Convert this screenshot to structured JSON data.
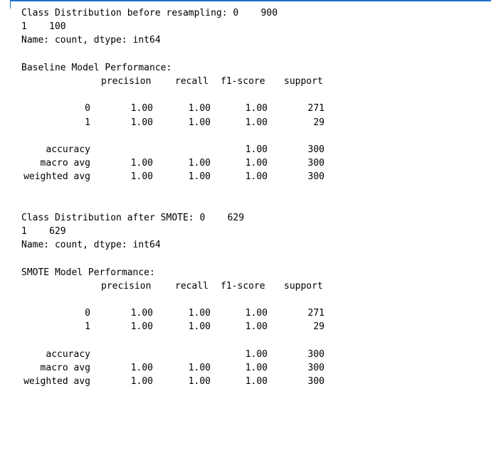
{
  "output": {
    "baseline": {
      "dist_line1": "Class Distribution before resampling: 0    900",
      "dist_line2": "1    100",
      "name_line": "Name: count, dtype: int64",
      "title": "Baseline Model Performance:",
      "header": {
        "precision": "precision",
        "recall": "recall",
        "f1": "f1-score",
        "support": "support"
      },
      "rows": [
        {
          "label": "0",
          "precision": "1.00",
          "recall": "1.00",
          "f1": "1.00",
          "support": "271"
        },
        {
          "label": "1",
          "precision": "1.00",
          "recall": "1.00",
          "f1": "1.00",
          "support": "29"
        }
      ],
      "summary": [
        {
          "label": "accuracy",
          "precision": "",
          "recall": "",
          "f1": "1.00",
          "support": "300"
        },
        {
          "label": "macro avg",
          "precision": "1.00",
          "recall": "1.00",
          "f1": "1.00",
          "support": "300"
        },
        {
          "label": "weighted avg",
          "precision": "1.00",
          "recall": "1.00",
          "f1": "1.00",
          "support": "300"
        }
      ]
    },
    "smote": {
      "dist_line1": "Class Distribution after SMOTE: 0    629",
      "dist_line2": "1    629",
      "name_line": "Name: count, dtype: int64",
      "title": "SMOTE Model Performance:",
      "header": {
        "precision": "precision",
        "recall": "recall",
        "f1": "f1-score",
        "support": "support"
      },
      "rows": [
        {
          "label": "0",
          "precision": "1.00",
          "recall": "1.00",
          "f1": "1.00",
          "support": "271"
        },
        {
          "label": "1",
          "precision": "1.00",
          "recall": "1.00",
          "f1": "1.00",
          "support": "29"
        }
      ],
      "summary": [
        {
          "label": "accuracy",
          "precision": "",
          "recall": "",
          "f1": "1.00",
          "support": "300"
        },
        {
          "label": "macro avg",
          "precision": "1.00",
          "recall": "1.00",
          "f1": "1.00",
          "support": "300"
        },
        {
          "label": "weighted avg",
          "precision": "1.00",
          "recall": "1.00",
          "f1": "1.00",
          "support": "300"
        }
      ]
    }
  }
}
